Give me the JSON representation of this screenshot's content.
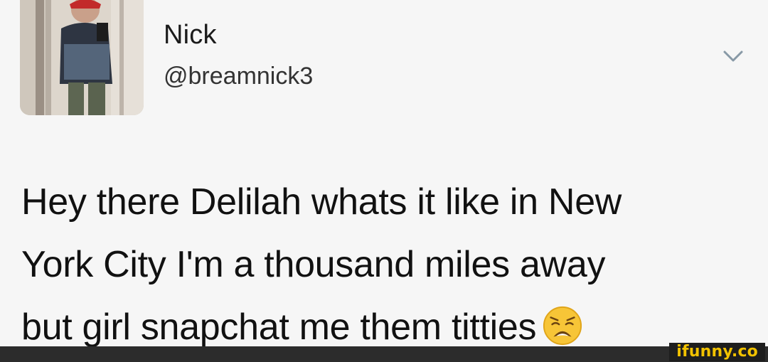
{
  "tweet": {
    "display_name": "Nick",
    "handle": "@breamnick3",
    "text_lines": [
      "Hey there Delilah whats it like in New",
      "York City I'm a thousand miles away",
      "but girl snapchat me them titties"
    ],
    "emoji": "weary-face-icon"
  },
  "icons": {
    "menu": "chevron-down-icon"
  },
  "watermark": {
    "text": "ifunny.co"
  },
  "colors": {
    "background": "#f6f6f6",
    "text": "#111111",
    "chevron": "#8899a6",
    "watermark_text": "#f2c200",
    "watermark_bg": "#1e1e1e"
  }
}
